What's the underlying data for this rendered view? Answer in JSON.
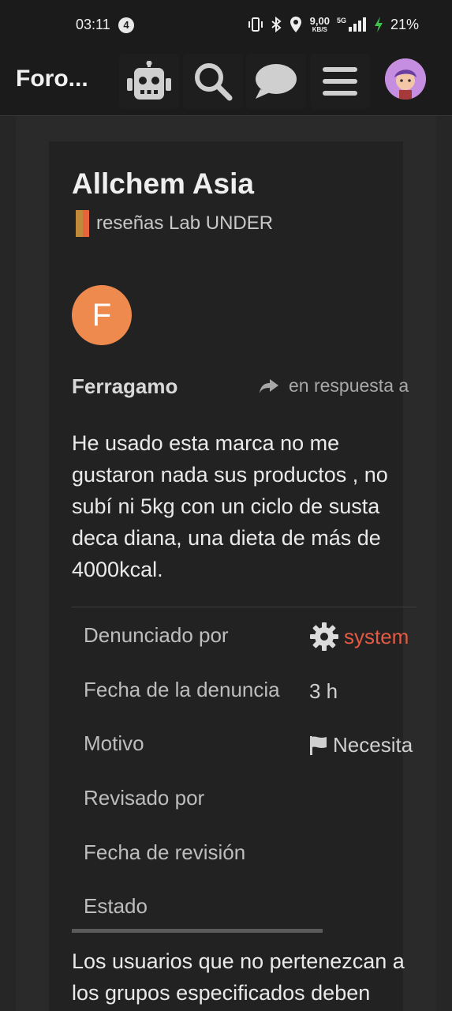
{
  "status_bar": {
    "time": "03:11",
    "notification_count": "4",
    "net_speed_value": "9,00",
    "net_speed_unit": "KB/S",
    "network_type": "5G",
    "battery": "21%"
  },
  "header": {
    "site_title": "Foro...",
    "icons": [
      "robot-icon",
      "search-icon",
      "chat-icon",
      "menu-icon",
      "user-avatar"
    ]
  },
  "topic": {
    "title": "Allchem Asia",
    "category": "reseñas Lab UNDER",
    "category_colors": [
      "#bf8a3a",
      "#e8643a"
    ]
  },
  "post": {
    "avatar_letter": "F",
    "avatar_color": "#ef8a4f",
    "username": "Ferragamo",
    "reply_label": "en respuesta a",
    "body": "He usado esta marca no me gustaron nada sus productos , no subí ni 5kg con un ciclo de susta deca diana, una dieta de más de 4000kcal."
  },
  "report": {
    "rows": [
      {
        "label": "Denunciado por",
        "value": "system"
      },
      {
        "label": "Fecha de la denuncia",
        "value": "3 h"
      },
      {
        "label": "Motivo",
        "value": "Necesita"
      },
      {
        "label": "Revisado por",
        "value": ""
      },
      {
        "label": "Fecha de revisión",
        "value": ""
      },
      {
        "label": "Estado",
        "value": ""
      }
    ]
  },
  "footer": {
    "text": "Los usuarios que no pertenezcan a los grupos especificados deben"
  }
}
